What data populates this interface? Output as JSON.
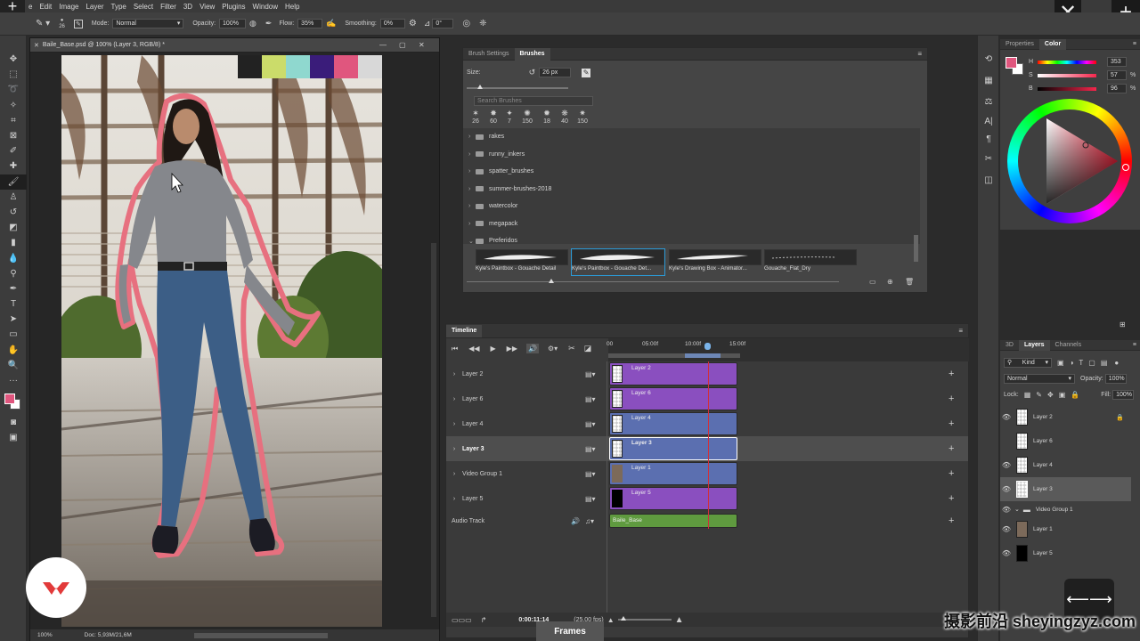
{
  "menu": [
    "e",
    "Edit",
    "Image",
    "Layer",
    "Type",
    "Select",
    "Filter",
    "3D",
    "View",
    "Plugins",
    "Window",
    "Help"
  ],
  "options": {
    "mode_label": "Mode:",
    "mode_value": "Normal",
    "opacity_label": "Opacity:",
    "opacity_value": "100%",
    "flow_label": "Flow:",
    "flow_value": "35%",
    "smoothing_label": "Smoothing:",
    "smoothing_value": "0%",
    "angle_value": "0°"
  },
  "brush_size_value": "26",
  "document": {
    "title": "Baile_Base.psd @ 100% (Layer 3, RGB/8) *",
    "zoom": "100%",
    "doc_info": "Doc: 5,93M/21,6M"
  },
  "swatches": [
    "#222222",
    "#cbdc6a",
    "#8fd8cf",
    "#3a1c7a",
    "#e0567e",
    "#d8d8d8"
  ],
  "brushes": {
    "tabs": [
      "Brush Settings",
      "Brushes"
    ],
    "size_label": "Size:",
    "size_value": "26 px",
    "search_placeholder": "Search Brushes",
    "presets": [
      "26",
      "60",
      "7",
      "150",
      "18",
      "40",
      "150"
    ],
    "folders": [
      "rakes",
      "runny_inkers",
      "spatter_brushes",
      "summer-brushes-2018",
      "watercolor",
      "megapack",
      "Preferidos"
    ],
    "strokes": [
      "Kyle's Paintbox - Gouache Detail",
      "Kyle's Paintbox - Gouache Det...",
      "Kyle's Drawing Box - Animator...",
      "Gouache_Flat_Dry"
    ]
  },
  "timeline": {
    "title": "Timeline",
    "ruler": [
      "00",
      "05:00f",
      "10:00f",
      "15:00f"
    ],
    "tracks": [
      "Layer 2",
      "Layer 6",
      "Layer 4",
      "Layer 3",
      "Video Group 1",
      "Layer 5"
    ],
    "clips": [
      "Layer 2",
      "Layer 6",
      "Layer 4",
      "Layer 3",
      "Layer 1",
      "Layer 5"
    ],
    "audio_label": "Audio Track",
    "audio_clip": "Baile_Base",
    "timecode": "0:00:11:14",
    "fps": "(25,00 fps)",
    "frames_button": "Frames"
  },
  "color_panel": {
    "tabs": [
      "Properties",
      "Color"
    ],
    "h_label": "H",
    "h_value": "353",
    "s_label": "S",
    "s_value": "57",
    "b_label": "B",
    "b_value": "96",
    "pct": "%",
    "foreground": "#e0567e"
  },
  "layers_panel": {
    "tabs": [
      "3D",
      "Layers",
      "Channels"
    ],
    "kind_label": "Kind",
    "blend_value": "Normal",
    "opacity_label": "Opacity:",
    "opacity_value": "100%",
    "lock_label": "Lock:",
    "fill_label": "Fill:",
    "fill_value": "100%",
    "layers": [
      "Layer 2",
      "Layer 6",
      "Layer 4",
      "Layer 3",
      "Video Group 1",
      "Layer 1",
      "Layer 5"
    ]
  },
  "watermark": "摄影前沿 sheyingzyz.com",
  "colors": {
    "purple_clip": "#8a4fbf",
    "blue_clip": "#5b6fb0",
    "green_clip": "#5f9a3f",
    "playhead": "#d0303a",
    "accent": "#2b9ad6"
  }
}
